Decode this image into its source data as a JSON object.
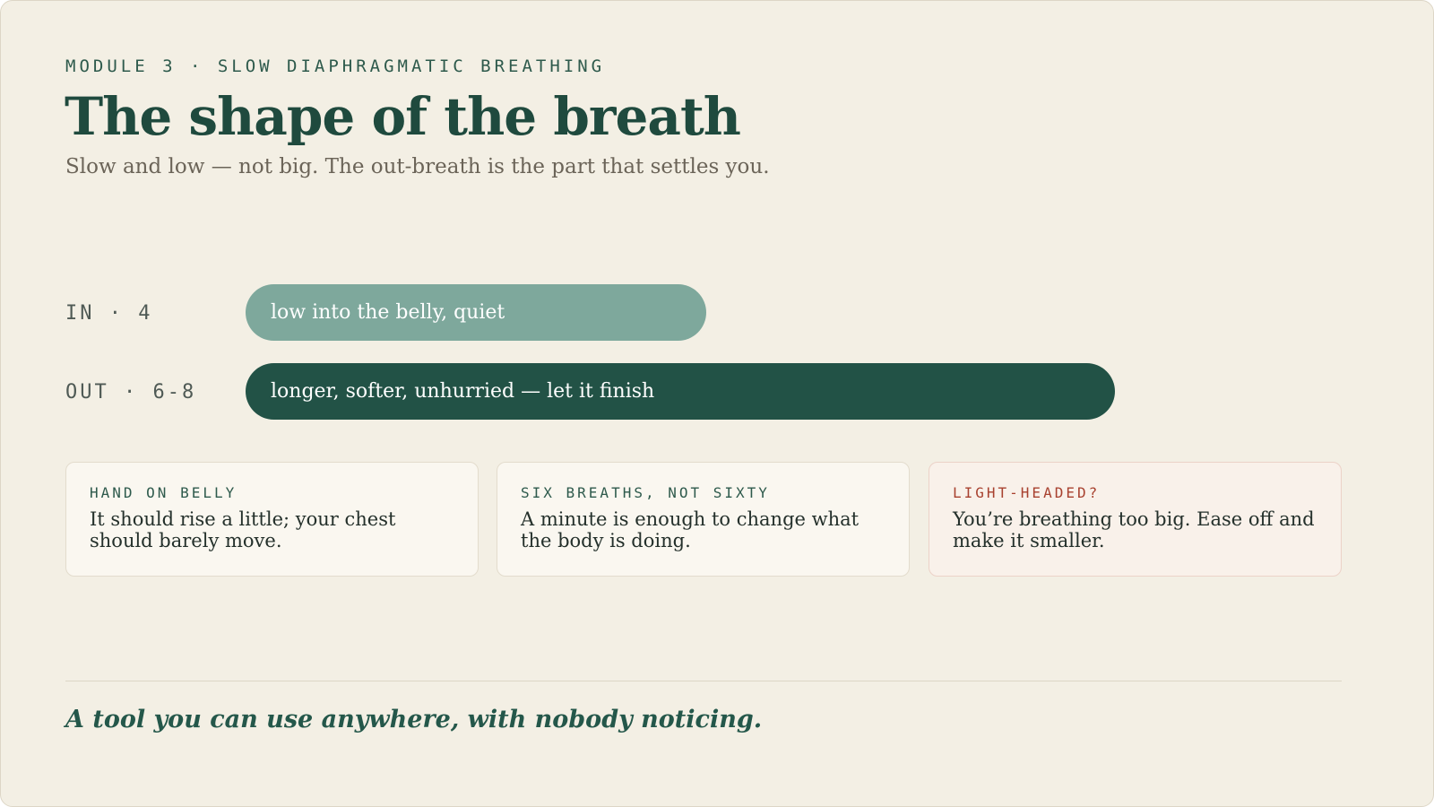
{
  "header": {
    "eyebrow": "MODULE 3 · SLOW DIAPHRAGMATIC BREATHING",
    "title": "The shape of the breath",
    "subtitle": "Slow and low — not big. The out-breath is the part that settles you."
  },
  "phases": [
    {
      "label": "IN · 4",
      "text": "low into the belly, quiet",
      "color": "#7ea89c",
      "relative_length": 0.53
    },
    {
      "label": "OUT · 6-8",
      "text": "longer, softer, unhurried — let it finish",
      "color": "#225246",
      "relative_length": 1.0
    }
  ],
  "cards": [
    {
      "kicker": "HAND ON BELLY",
      "text": "It should rise a little; your chest should barely move."
    },
    {
      "kicker": "SIX BREATHS, NOT SIXTY",
      "text": "A minute is enough to change what the body is doing."
    },
    {
      "kicker": "LIGHT-HEADED?",
      "text": "You’re breathing too big. Ease off and make it smaller."
    }
  ],
  "footer": {
    "tagline": "A tool you can use anywhere, with nobody noticing."
  },
  "colors": {
    "background": "#f3efe4",
    "accent_dark": "#225246",
    "accent_light": "#7ea89c",
    "warning": "#a8412f"
  }
}
